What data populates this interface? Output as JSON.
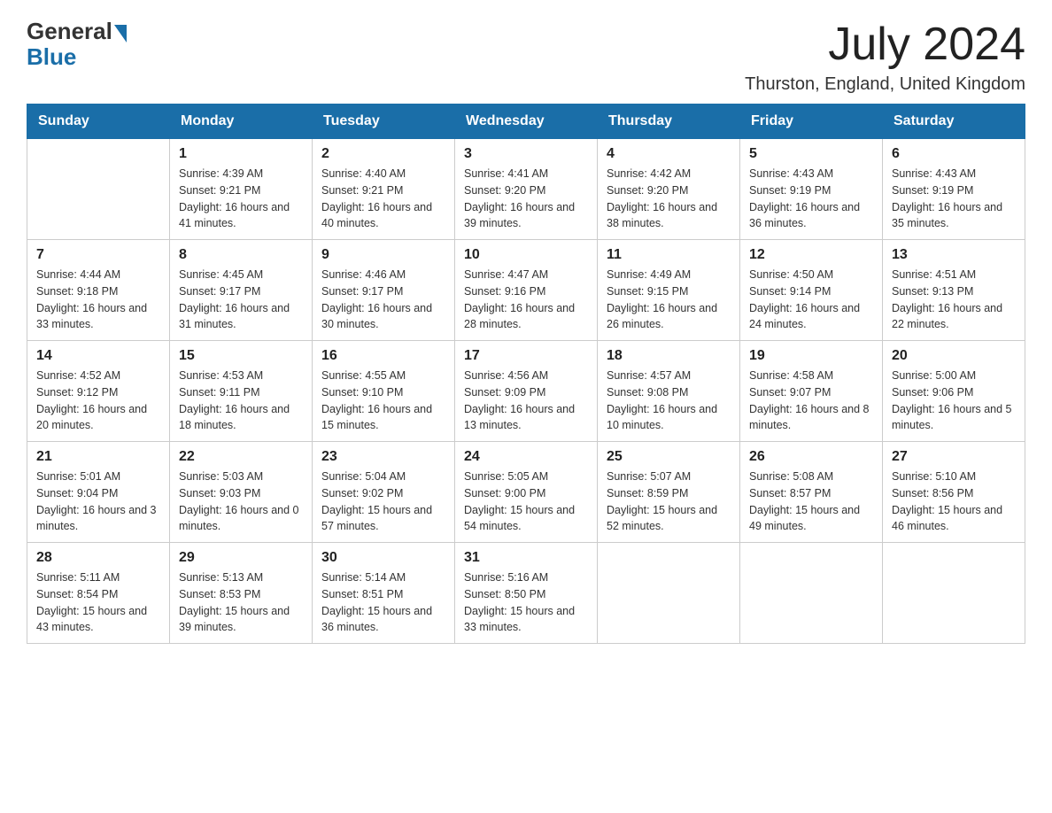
{
  "header": {
    "logo_general": "General",
    "logo_blue": "Blue",
    "month_title": "July 2024",
    "location": "Thurston, England, United Kingdom"
  },
  "weekdays": [
    "Sunday",
    "Monday",
    "Tuesday",
    "Wednesday",
    "Thursday",
    "Friday",
    "Saturday"
  ],
  "weeks": [
    [
      {
        "day": "",
        "sunrise": "",
        "sunset": "",
        "daylight": ""
      },
      {
        "day": "1",
        "sunrise": "Sunrise: 4:39 AM",
        "sunset": "Sunset: 9:21 PM",
        "daylight": "Daylight: 16 hours and 41 minutes."
      },
      {
        "day": "2",
        "sunrise": "Sunrise: 4:40 AM",
        "sunset": "Sunset: 9:21 PM",
        "daylight": "Daylight: 16 hours and 40 minutes."
      },
      {
        "day": "3",
        "sunrise": "Sunrise: 4:41 AM",
        "sunset": "Sunset: 9:20 PM",
        "daylight": "Daylight: 16 hours and 39 minutes."
      },
      {
        "day": "4",
        "sunrise": "Sunrise: 4:42 AM",
        "sunset": "Sunset: 9:20 PM",
        "daylight": "Daylight: 16 hours and 38 minutes."
      },
      {
        "day": "5",
        "sunrise": "Sunrise: 4:43 AM",
        "sunset": "Sunset: 9:19 PM",
        "daylight": "Daylight: 16 hours and 36 minutes."
      },
      {
        "day": "6",
        "sunrise": "Sunrise: 4:43 AM",
        "sunset": "Sunset: 9:19 PM",
        "daylight": "Daylight: 16 hours and 35 minutes."
      }
    ],
    [
      {
        "day": "7",
        "sunrise": "Sunrise: 4:44 AM",
        "sunset": "Sunset: 9:18 PM",
        "daylight": "Daylight: 16 hours and 33 minutes."
      },
      {
        "day": "8",
        "sunrise": "Sunrise: 4:45 AM",
        "sunset": "Sunset: 9:17 PM",
        "daylight": "Daylight: 16 hours and 31 minutes."
      },
      {
        "day": "9",
        "sunrise": "Sunrise: 4:46 AM",
        "sunset": "Sunset: 9:17 PM",
        "daylight": "Daylight: 16 hours and 30 minutes."
      },
      {
        "day": "10",
        "sunrise": "Sunrise: 4:47 AM",
        "sunset": "Sunset: 9:16 PM",
        "daylight": "Daylight: 16 hours and 28 minutes."
      },
      {
        "day": "11",
        "sunrise": "Sunrise: 4:49 AM",
        "sunset": "Sunset: 9:15 PM",
        "daylight": "Daylight: 16 hours and 26 minutes."
      },
      {
        "day": "12",
        "sunrise": "Sunrise: 4:50 AM",
        "sunset": "Sunset: 9:14 PM",
        "daylight": "Daylight: 16 hours and 24 minutes."
      },
      {
        "day": "13",
        "sunrise": "Sunrise: 4:51 AM",
        "sunset": "Sunset: 9:13 PM",
        "daylight": "Daylight: 16 hours and 22 minutes."
      }
    ],
    [
      {
        "day": "14",
        "sunrise": "Sunrise: 4:52 AM",
        "sunset": "Sunset: 9:12 PM",
        "daylight": "Daylight: 16 hours and 20 minutes."
      },
      {
        "day": "15",
        "sunrise": "Sunrise: 4:53 AM",
        "sunset": "Sunset: 9:11 PM",
        "daylight": "Daylight: 16 hours and 18 minutes."
      },
      {
        "day": "16",
        "sunrise": "Sunrise: 4:55 AM",
        "sunset": "Sunset: 9:10 PM",
        "daylight": "Daylight: 16 hours and 15 minutes."
      },
      {
        "day": "17",
        "sunrise": "Sunrise: 4:56 AM",
        "sunset": "Sunset: 9:09 PM",
        "daylight": "Daylight: 16 hours and 13 minutes."
      },
      {
        "day": "18",
        "sunrise": "Sunrise: 4:57 AM",
        "sunset": "Sunset: 9:08 PM",
        "daylight": "Daylight: 16 hours and 10 minutes."
      },
      {
        "day": "19",
        "sunrise": "Sunrise: 4:58 AM",
        "sunset": "Sunset: 9:07 PM",
        "daylight": "Daylight: 16 hours and 8 minutes."
      },
      {
        "day": "20",
        "sunrise": "Sunrise: 5:00 AM",
        "sunset": "Sunset: 9:06 PM",
        "daylight": "Daylight: 16 hours and 5 minutes."
      }
    ],
    [
      {
        "day": "21",
        "sunrise": "Sunrise: 5:01 AM",
        "sunset": "Sunset: 9:04 PM",
        "daylight": "Daylight: 16 hours and 3 minutes."
      },
      {
        "day": "22",
        "sunrise": "Sunrise: 5:03 AM",
        "sunset": "Sunset: 9:03 PM",
        "daylight": "Daylight: 16 hours and 0 minutes."
      },
      {
        "day": "23",
        "sunrise": "Sunrise: 5:04 AM",
        "sunset": "Sunset: 9:02 PM",
        "daylight": "Daylight: 15 hours and 57 minutes."
      },
      {
        "day": "24",
        "sunrise": "Sunrise: 5:05 AM",
        "sunset": "Sunset: 9:00 PM",
        "daylight": "Daylight: 15 hours and 54 minutes."
      },
      {
        "day": "25",
        "sunrise": "Sunrise: 5:07 AM",
        "sunset": "Sunset: 8:59 PM",
        "daylight": "Daylight: 15 hours and 52 minutes."
      },
      {
        "day": "26",
        "sunrise": "Sunrise: 5:08 AM",
        "sunset": "Sunset: 8:57 PM",
        "daylight": "Daylight: 15 hours and 49 minutes."
      },
      {
        "day": "27",
        "sunrise": "Sunrise: 5:10 AM",
        "sunset": "Sunset: 8:56 PM",
        "daylight": "Daylight: 15 hours and 46 minutes."
      }
    ],
    [
      {
        "day": "28",
        "sunrise": "Sunrise: 5:11 AM",
        "sunset": "Sunset: 8:54 PM",
        "daylight": "Daylight: 15 hours and 43 minutes."
      },
      {
        "day": "29",
        "sunrise": "Sunrise: 5:13 AM",
        "sunset": "Sunset: 8:53 PM",
        "daylight": "Daylight: 15 hours and 39 minutes."
      },
      {
        "day": "30",
        "sunrise": "Sunrise: 5:14 AM",
        "sunset": "Sunset: 8:51 PM",
        "daylight": "Daylight: 15 hours and 36 minutes."
      },
      {
        "day": "31",
        "sunrise": "Sunrise: 5:16 AM",
        "sunset": "Sunset: 8:50 PM",
        "daylight": "Daylight: 15 hours and 33 minutes."
      },
      {
        "day": "",
        "sunrise": "",
        "sunset": "",
        "daylight": ""
      },
      {
        "day": "",
        "sunrise": "",
        "sunset": "",
        "daylight": ""
      },
      {
        "day": "",
        "sunrise": "",
        "sunset": "",
        "daylight": ""
      }
    ]
  ]
}
